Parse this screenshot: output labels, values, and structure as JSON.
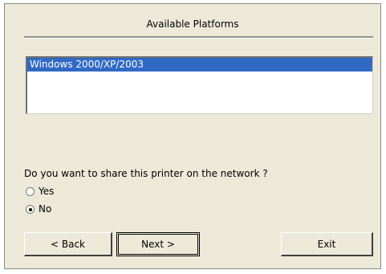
{
  "header": {
    "title": "Available Platforms"
  },
  "platforms": {
    "items": [
      {
        "label": "Windows 2000/XP/2003",
        "selected": true
      }
    ]
  },
  "share": {
    "question": "Do you want to share this printer on the network ?",
    "options": [
      {
        "label": "Yes",
        "checked": false
      },
      {
        "label": "No",
        "checked": true
      }
    ]
  },
  "buttons": {
    "back": "< Back",
    "next": "Next >",
    "exit": "Exit"
  },
  "colors": {
    "selection": "#316ac5",
    "dialog_bg": "#ece9d8"
  }
}
